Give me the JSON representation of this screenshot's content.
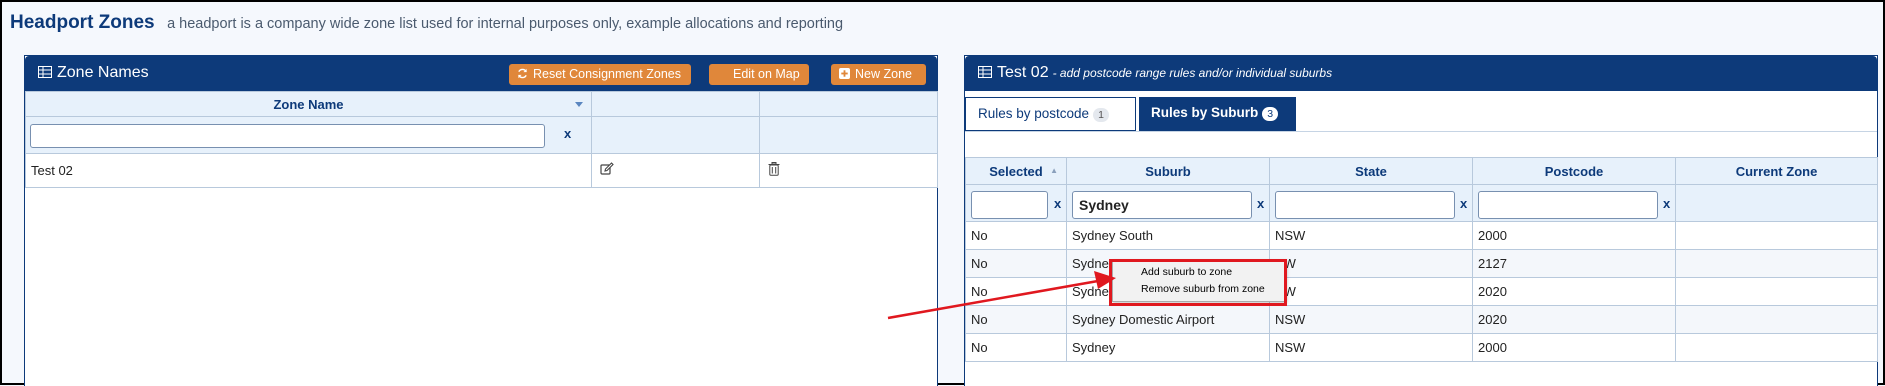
{
  "page": {
    "title": "Headport Zones",
    "subtitle": "a headport is a company wide zone list used for internal purposes only, example allocations and reporting"
  },
  "left_panel": {
    "title": "Zone Names",
    "buttons": {
      "reset_consignment": "Reset Consignment Zones",
      "edit_on_map": "Edit on Map",
      "new_zone": "New Zone"
    },
    "table": {
      "header": "Zone Name",
      "filter_value": "",
      "clear_label": "x",
      "rows": [
        {
          "name": "Test 02"
        }
      ]
    }
  },
  "right_panel": {
    "title": "Test 02",
    "subtitle": "- add postcode range rules and/or individual suburbs",
    "tabs": [
      {
        "label": "Rules by postcode",
        "count": "1",
        "active": false
      },
      {
        "label": "Rules by Suburb",
        "count": "3",
        "active": true
      }
    ],
    "table": {
      "columns": [
        "Selected",
        "Suburb",
        "State",
        "Postcode",
        "Current Zone"
      ],
      "filters": {
        "selected": "",
        "suburb": "Sydney",
        "state": "",
        "postcode": ""
      },
      "clear_label": "x",
      "rows": [
        {
          "selected": "No",
          "suburb": "Sydney South",
          "state": "NSW",
          "postcode": "2000",
          "zone": ""
        },
        {
          "selected": "No",
          "suburb": "Sydney",
          "state": "SW",
          "postcode": "2127",
          "zone": ""
        },
        {
          "selected": "No",
          "suburb": "Sydney",
          "state": "SW",
          "postcode": "2020",
          "zone": ""
        },
        {
          "selected": "No",
          "suburb": "Sydney Domestic Airport",
          "state": "NSW",
          "postcode": "2020",
          "zone": ""
        },
        {
          "selected": "No",
          "suburb": "Sydney",
          "state": "NSW",
          "postcode": "2000",
          "zone": ""
        }
      ]
    }
  },
  "context_menu": {
    "items": [
      "Add suburb to zone",
      "Remove suburb from zone"
    ]
  },
  "colors": {
    "primary": "#0d3a7a",
    "button_orange": "#e0873a",
    "annotation_red": "#e0181f",
    "table_header_bg": "#e7f1fb",
    "page_bg": "#f5f8fd"
  },
  "icons": {
    "panel": "table-grid-icon",
    "reset": "refresh-icon",
    "new": "plus-square-icon",
    "edit": "edit-icon",
    "delete": "trash-icon"
  }
}
